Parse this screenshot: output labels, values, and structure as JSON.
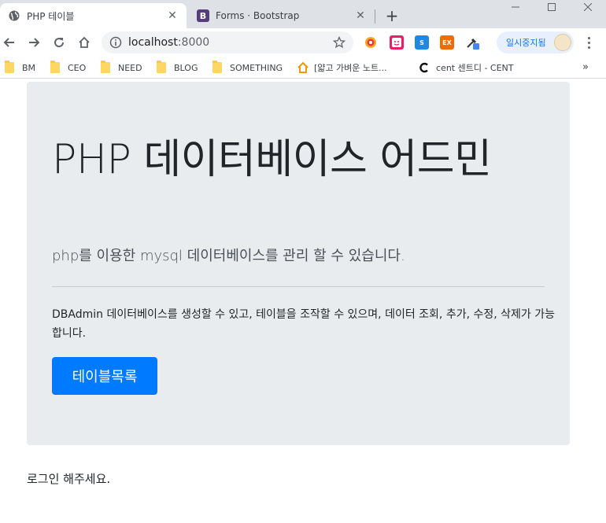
{
  "browser": {
    "tabs": [
      {
        "title": "PHP 테이블",
        "favicon": "globe-icon",
        "active": true
      },
      {
        "title": "Forms · Bootstrap",
        "favicon": "bootstrap-icon",
        "active": false
      }
    ],
    "address": {
      "host": "localhost",
      "port": ":8000"
    },
    "profile_label": "일시중지됨",
    "bookmarks": [
      {
        "label": "BM",
        "icon": "folder-icon"
      },
      {
        "label": "CEO",
        "icon": "folder-icon"
      },
      {
        "label": "NEED",
        "icon": "folder-icon"
      },
      {
        "label": "BLOG",
        "icon": "folder-icon"
      },
      {
        "label": "SOMETHING",
        "icon": "folder-icon"
      },
      {
        "label": "[얇고 가벼운 노트...",
        "icon": "house-icon"
      },
      {
        "label": "cent 센트디 - CENT",
        "icon": "c-logo-icon"
      }
    ],
    "bookmarks_overflow": "»"
  },
  "page": {
    "heading": "PHP 데이터베이스 어드민",
    "lead": "php를 이용한 mysql 데이터베이스를 관리 할 수 있습니다.",
    "description": "DBAdmin 데이터베이스를 생성할 수 있고, 테이블을 조작할 수 있으며, 데이터 조회, 추가, 수정, 삭제가 가능합니다.",
    "table_list_button": "테이블목록",
    "login_message": "로그인 해주세요."
  },
  "colors": {
    "primary": "#007bff",
    "jumbotron_bg": "#e9ecef",
    "tab_strip": "#dee1e6"
  }
}
